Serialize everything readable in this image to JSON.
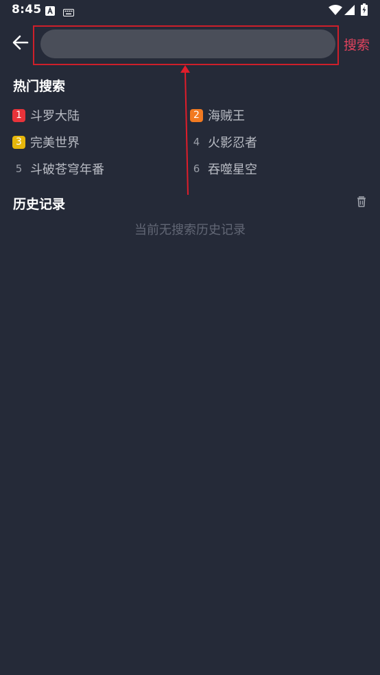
{
  "status_bar": {
    "time": "8:45",
    "icons": [
      "a-notification-icon",
      "keyboard-icon",
      "wifi-icon",
      "signal-icon",
      "battery-charging-icon"
    ]
  },
  "header": {
    "back_icon": "arrow-left-icon",
    "search_placeholder": "",
    "search_value": "",
    "search_button_label": "搜索"
  },
  "hot_search": {
    "title": "热门搜索",
    "items": [
      {
        "rank": "1",
        "label": "斗罗大陆",
        "badge_color": "#e8333a"
      },
      {
        "rank": "2",
        "label": "海贼王",
        "badge_color": "#f27a21"
      },
      {
        "rank": "3",
        "label": "完美世界",
        "badge_color": "#e6b60b"
      },
      {
        "rank": "4",
        "label": "火影忍者",
        "badge_color": ""
      },
      {
        "rank": "5",
        "label": "斗破苍穹年番",
        "badge_color": ""
      },
      {
        "rank": "6",
        "label": "吞噬星空",
        "badge_color": ""
      }
    ]
  },
  "history": {
    "title": "历史记录",
    "clear_icon": "trash-icon",
    "empty_text": "当前无搜索历史记录"
  },
  "colors": {
    "background": "#252a38",
    "accent": "#e0435d",
    "search_field": "#4a4e59",
    "annotation": "#cf1f2a"
  }
}
